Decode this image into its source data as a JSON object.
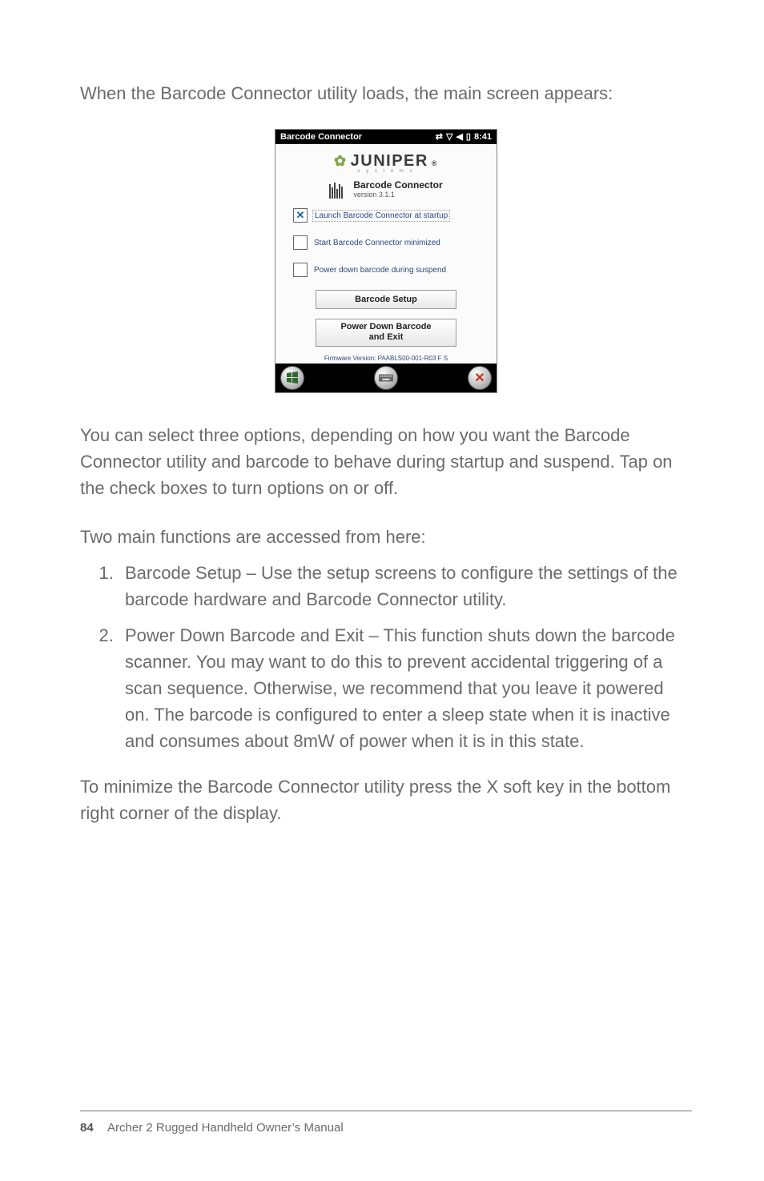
{
  "intro": "When the Barcode Connector utility loads, the main screen appears:",
  "screenshot": {
    "titlebar": {
      "title": "Barcode Connector",
      "time": "8:41"
    },
    "brand": {
      "name": "JUNIPER",
      "reg": "®",
      "sub": "s y s t e m s"
    },
    "app": {
      "title": "Barcode Connector",
      "version": "version 3.1.1"
    },
    "options": [
      {
        "checked": true,
        "label": "Launch Barcode Connector at startup",
        "highlighted": true
      },
      {
        "checked": false,
        "label": "Start Barcode Connector minimized",
        "highlighted": false
      },
      {
        "checked": false,
        "label": "Power down barcode during suspend",
        "highlighted": false
      }
    ],
    "buttons": {
      "setup": "Barcode Setup",
      "power_line1": "Power Down Barcode",
      "power_line2": "and Exit"
    },
    "firmware": "Firmware Version: PAABLS00-001-R03   F S"
  },
  "para_options": "You can select three options, depending on how you want the Barcode Connector utility and barcode to behave during startup and suspend. Tap on the check boxes to turn options on or off.",
  "para_two": "Two main functions are accessed from here:",
  "list": [
    "Barcode Setup – Use the setup screens to configure the settings of the barcode hardware and Barcode Connector utility.",
    "Power Down Barcode and Exit – This function shuts down the barcode scanner. You may want to do this to prevent accidental triggering of a scan sequence. Otherwise, we recommend that you leave it powered on. The barcode is configured to enter a sleep state when it is inactive and consumes about 8mW of power when it is in this state."
  ],
  "para_min": "To minimize the Barcode Connector utility press the X soft key in the bottom right corner of the display.",
  "footer": {
    "page": "84",
    "title": "Archer 2 Rugged Handheld Owner’s Manual"
  }
}
